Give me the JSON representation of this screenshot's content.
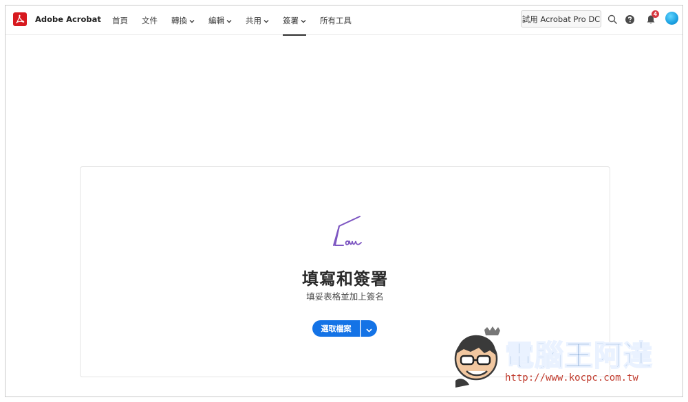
{
  "app": {
    "brand_name": "Adobe Acrobat",
    "brand_color": "#d7191f"
  },
  "nav": {
    "items": [
      {
        "label": "首頁",
        "dropdown": false
      },
      {
        "label": "文件",
        "dropdown": false
      },
      {
        "label": "轉換",
        "dropdown": true
      },
      {
        "label": "編輯",
        "dropdown": true
      },
      {
        "label": "共用",
        "dropdown": true
      },
      {
        "label": "簽署",
        "dropdown": true,
        "active": true
      },
      {
        "label": "所有工具",
        "dropdown": false
      }
    ]
  },
  "header": {
    "trial_label": "試用 Acrobat Pro DC",
    "notification_count": "4",
    "icons": [
      "search-icon",
      "help-icon",
      "bell-icon",
      "avatar"
    ]
  },
  "card": {
    "title": "填寫和簽署",
    "subtitle": "填妥表格並加上簽名",
    "primary_button": "選取檔案",
    "accent_color": "#1473e6",
    "signature_color": "#7e57c2"
  },
  "watermark": {
    "title": "電腦王阿達",
    "url": "http://www.kocpc.com.tw"
  }
}
